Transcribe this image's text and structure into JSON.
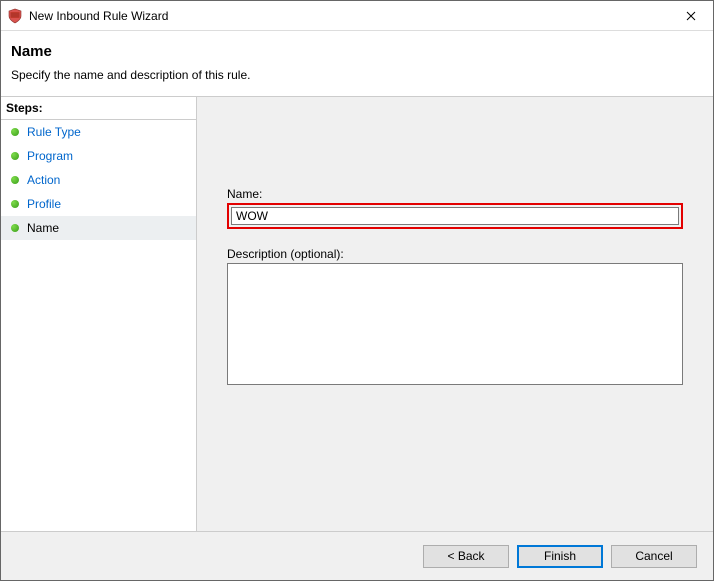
{
  "window": {
    "title": "New Inbound Rule Wizard"
  },
  "header": {
    "title": "Name",
    "subtitle": "Specify the name and description of this rule."
  },
  "sidebar": {
    "steps_label": "Steps:",
    "items": [
      {
        "label": "Rule Type"
      },
      {
        "label": "Program"
      },
      {
        "label": "Action"
      },
      {
        "label": "Profile"
      },
      {
        "label": "Name"
      }
    ],
    "current_index": 4
  },
  "form": {
    "name_label": "Name:",
    "name_value": "WOW",
    "desc_label": "Description (optional):",
    "desc_value": ""
  },
  "footer": {
    "back": "< Back",
    "finish": "Finish",
    "cancel": "Cancel"
  }
}
